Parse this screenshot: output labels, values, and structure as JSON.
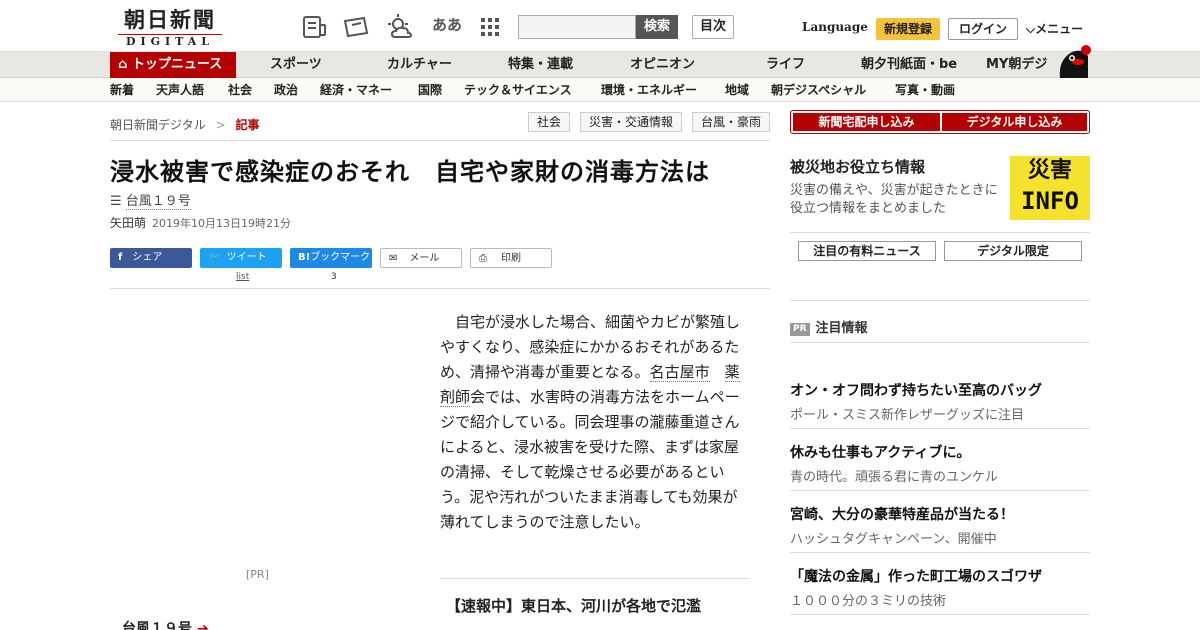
{
  "header": {
    "logo_top": "朝日新聞",
    "logo_bottom": "DIGITAL",
    "search_button": "検索",
    "toc_button": "目次",
    "language": "Language",
    "register": "新規登録",
    "login": "ログイン",
    "menu": "メニュー",
    "font_size_icon_text": "ああ"
  },
  "nav_primary": [
    "トップニュース",
    "スポーツ",
    "カルチャー",
    "特集・連載",
    "オピニオン",
    "ライフ",
    "朝夕刊紙面・be",
    "MY朝デジ"
  ],
  "nav_secondary": [
    "新着",
    "天声人語",
    "社会",
    "政治",
    "経済・マネー",
    "国際",
    "テック＆サイエンス",
    "環境・エネルギー",
    "地域",
    "朝デジスペシャル",
    "写真・動画"
  ],
  "breadcrumb": {
    "home": "朝日新聞デジタル",
    "sep": ">",
    "current": "記事"
  },
  "tags": [
    "社会",
    "災害・交通情報",
    "台風・豪雨"
  ],
  "article": {
    "title": "浸水被害で感染症のおそれ　自宅や家財の消毒方法は",
    "topic": "台風１９号",
    "author": "矢田萌",
    "date": "2019年10月13日19時21分",
    "body_1": "自宅が浸水した場合、細菌やカビが繁殖しやすくなり、感染症にかかるおそれがあるため、清掃や消毒が重要となる。",
    "body_link1": "名古屋市",
    "body_link2": "薬剤師",
    "body_2": "会では、水害時の消毒方法をホームページで紹介している。同会理事の瀧藤重道さんによると、浸水被害を受けた際、まずは家屋の清掃、そして乾燥させる必要があるという。泥や汚れがついたまま消毒しても効果が薄れてしまうので注意したい。",
    "breaking": "【速報中】東日本、河川が各地で氾濫",
    "pr_label": "[PR]",
    "typhoon_link": "台風１９号"
  },
  "share": {
    "facebook": "シェア",
    "twitter": "ツイート",
    "twitter_count": "list",
    "bookmark": "ブックマーク",
    "bookmark_count": "3",
    "mail": "メール",
    "print": "印刷"
  },
  "sidebar": {
    "btn_paper": "新聞宅配申し込み",
    "btn_digital": "デジタル申し込み",
    "disaster_title": "被災地お役立ち情報",
    "disaster_text": "災害の備えや、災害が起きたときに役立つ情報をまとめました",
    "info_top": "災害",
    "info_bottom": "INFO",
    "btn_paid_news": "注目の有料ニュース",
    "btn_digital_only": "デジタル限定",
    "pr_badge": "PR",
    "pr_heading": "注目情報",
    "ads": [
      {
        "title": "オン・オフ問わず持ちたい至高のバッグ",
        "sub": "ポール・スミス新作レザーグッズに注目"
      },
      {
        "title": "休みも仕事もアクティブに。",
        "sub": "青の時代。頑張る君に青のユンケル"
      },
      {
        "title": "宮崎、大分の豪華特産品が当たる！",
        "sub": "ハッシュタグキャンペーン、開催中"
      },
      {
        "title": "「魔法の金属」作った町工場のスゴワザ",
        "sub": "１０００分の３ミリの技術"
      }
    ]
  },
  "colors": {
    "brand_red": "#b30000",
    "register_yellow": "#f5c33b",
    "nav_bg": "#e9e7e1"
  }
}
